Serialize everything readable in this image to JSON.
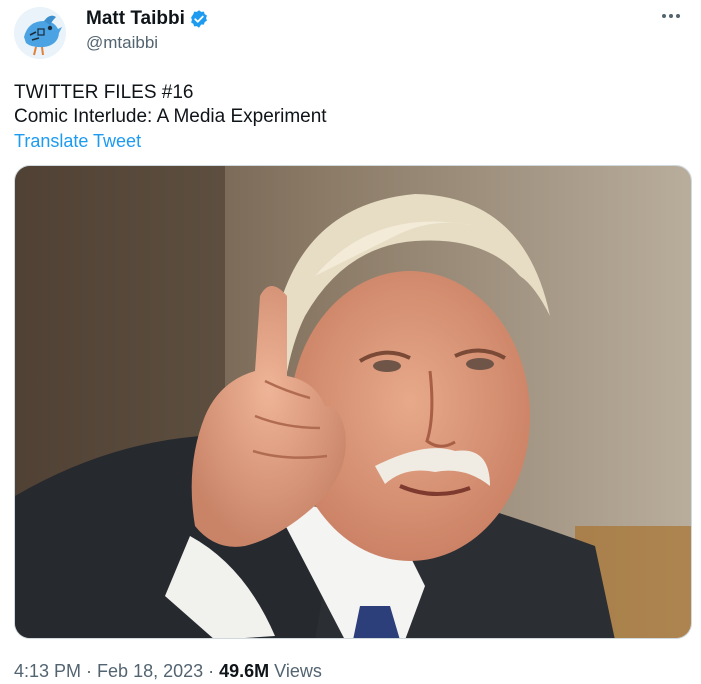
{
  "author": {
    "display_name": "Matt Taibbi",
    "handle": "@mtaibbi",
    "verified_icon": "verified-badge-icon",
    "avatar_icon": "blue-bird-avatar"
  },
  "more_icon": "more-options-icon",
  "tweet": {
    "line1": "TWITTER FILES #16",
    "line2": "Comic Interlude: A Media Experiment",
    "translate_label": "Translate Tweet"
  },
  "media": {
    "alt": "Photo of an older man with white hair and mustache pointing his finger"
  },
  "meta": {
    "time": "4:13 PM",
    "sep1": "·",
    "date": "Feb 18, 2023",
    "sep2": "·",
    "views_count": "49.6M",
    "views_label": "Views"
  },
  "colors": {
    "link": "#1d9bf0",
    "verified": "#1d9bf0",
    "secondary_text": "#536471"
  }
}
